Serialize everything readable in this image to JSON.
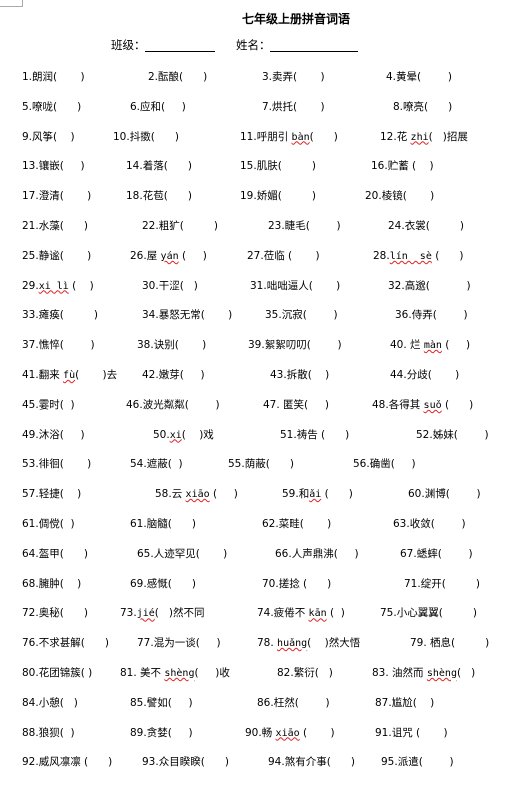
{
  "title": "七年级上册拼音词语",
  "fields": {
    "class_label": "班级：",
    "name_label": "姓名："
  },
  "rows": [
    [
      {
        "pre": "1.朗润(       )"
      },
      {
        "pre": "2.酝酿(      )"
      },
      {
        "pre": "3.卖弄(       )"
      },
      {
        "pre": "4.黄晕(        )"
      }
    ],
    [
      {
        "pre": "5.嘹咙(      )"
      },
      {
        "pre": "6.应和(     )"
      },
      {
        "pre": "7.烘托(       )"
      },
      {
        "pre": "8.嘹亮(      )"
      }
    ],
    [
      {
        "pre": "9.风筝(    )"
      },
      {
        "pre": "10.抖擞(      )"
      },
      {
        "pre": "11.呼朋引 ",
        "py": "bàn",
        "post": "(      )"
      },
      {
        "pre": "12.花 ",
        "py": "zhi",
        "post": "(   )招展"
      }
    ],
    [
      {
        "pre": "13.镶嵌(     )"
      },
      {
        "pre": "14.着落(      )"
      },
      {
        "pre": "15.肌肤(         )"
      },
      {
        "pre": "16.贮蓄 (    )"
      }
    ],
    [
      {
        "pre": "17.澄清(       )"
      },
      {
        "pre": "18.花苞(      )"
      },
      {
        "pre": "19.娇媚(         )"
      },
      {
        "pre": "20.棱镜(       )"
      }
    ],
    [
      {
        "pre": "21.水藻(      )"
      },
      {
        "pre": "22.粗犷(         )"
      },
      {
        "pre": "23.睫毛(        )"
      },
      {
        "pre": "24.衣裳(         )"
      }
    ],
    [
      {
        "pre": "25.静谧(       )"
      },
      {
        "pre": "26.屋 ",
        "py": "yán",
        "post": " (     )"
      },
      {
        "pre": "27.莅临 (       )"
      },
      {
        "pre": "28.",
        "py": "lín  sè",
        "post": " (      )"
      }
    ],
    [
      {
        "pre": "29.",
        "py": "xi lì",
        "post": " (    )"
      },
      {
        "pre": "30.干涩(   )"
      },
      {
        "pre": "31.咄咄逼人(       )"
      },
      {
        "pre": "32.高邈(           )"
      }
    ],
    [
      {
        "pre": "33.瘫痪(         )"
      },
      {
        "pre": "34.暴怒无常(       )"
      },
      {
        "pre": "35.沉寂(        )"
      },
      {
        "pre": "36.侍弄(        )"
      }
    ],
    [
      {
        "pre": "37.憔悴(        )"
      },
      {
        "pre": "38.诀别(       )"
      },
      {
        "pre": "39.絮絮叨叨(        )"
      },
      {
        "pre": "40. 烂 ",
        "py": "màn",
        "post": " (     )"
      }
    ],
    [
      {
        "pre": "41.翻来 ",
        "py": "fù",
        "post": "(       )去"
      },
      {
        "pre": "42.嫩芽(     )"
      },
      {
        "pre": "43.拆散(    )"
      },
      {
        "pre": "44.分歧(       )"
      }
    ],
    [
      {
        "pre": "45.霎时(  )"
      },
      {
        "pre": "46.波光粼粼(        )"
      },
      {
        "pre": "47. 匿笑(     )"
      },
      {
        "pre": "48.各得其 ",
        "py": "suǒ",
        "post": " (      )"
      }
    ],
    [
      {
        "pre": "49.沐浴(     )"
      },
      {
        "pre": "50.",
        "py": "xi",
        "post": "(    )戏"
      },
      {
        "pre": "51.祷告 (      )"
      },
      {
        "pre": "52.姊妹(        )"
      }
    ],
    [
      {
        "pre": "53.徘徊(       )"
      },
      {
        "pre": "54.遮蔽(  )"
      },
      {
        "pre": "55.荫蔽(      )"
      },
      {
        "pre": "56.确凿(     )"
      }
    ],
    [
      {
        "pre": "57.轻捷(    )"
      },
      {
        "pre": "58.云 ",
        "py": "xiāo",
        "post": " (     )"
      },
      {
        "pre": "59.和",
        "py": "ǎi",
        "post": " (      )"
      },
      {
        "pre": "60.渊博(        )"
      }
    ],
    [
      {
        "pre": "61.倜傥(  )"
      },
      {
        "pre": "61.脑髓(      )"
      },
      {
        "pre": "62.菜畦(       )"
      },
      {
        "pre": "63.收敛(        )"
      }
    ],
    [
      {
        "pre": "64.盔甲(      )"
      },
      {
        "pre": "65.人迹罕见(       )"
      },
      {
        "pre": "66.人声鼎沸(     )"
      },
      {
        "pre": "67.蟋蟀(        )"
      }
    ],
    [
      {
        "pre": "68.臃肿(    )"
      },
      {
        "pre": "69.感慨(      )"
      },
      {
        "pre": "70.搓捻 (      )"
      },
      {
        "pre": "71.绽开(         )"
      }
    ],
    [
      {
        "pre": "72.奥秘(      )"
      },
      {
        "pre": "73.",
        "py": "jié",
        "post": "(   )然不同"
      },
      {
        "pre": "74.疲倦不 ",
        "py": "kān",
        "post": " (  )"
      },
      {
        "pre": "75.小心翼翼(         )"
      }
    ],
    [
      {
        "pre": "76.不求甚解(      )"
      },
      {
        "pre": "77.混为一谈(     )"
      },
      {
        "pre": "78. ",
        "py": "huǎng",
        "post": "(    )然大悟"
      },
      {
        "pre": "79. 栖息(         )"
      }
    ],
    [
      {
        "pre": "80.花团锦簇( )"
      },
      {
        "pre": "81. 美不 ",
        "py": "shèng",
        "post": "(     )收"
      },
      {
        "pre": "82.繁衍(   )"
      },
      {
        "pre": "83. 油然而 ",
        "py": "shèng",
        "post": "(   )"
      }
    ],
    [
      {
        "pre": "84.小憩(   )"
      },
      {
        "pre": "85.譬如(     )"
      },
      {
        "pre": "86.枉然(        )"
      },
      {
        "pre": "87.尴尬(    )"
      }
    ],
    [
      {
        "pre": "88.狼狈(  )"
      },
      {
        "pre": "89.贪婪(     )"
      },
      {
        "pre": "90.畅 ",
        "py": "xiāo",
        "post": " (       )"
      },
      {
        "pre": "91.诅咒 (       )"
      }
    ],
    [
      {
        "pre": "92.威风凛凛 (      )"
      },
      {
        "pre": "93.众目睽睽(      )"
      },
      {
        "pre": "94.煞有介事(      )"
      },
      {
        "pre": "95.派遣(        )"
      }
    ]
  ]
}
